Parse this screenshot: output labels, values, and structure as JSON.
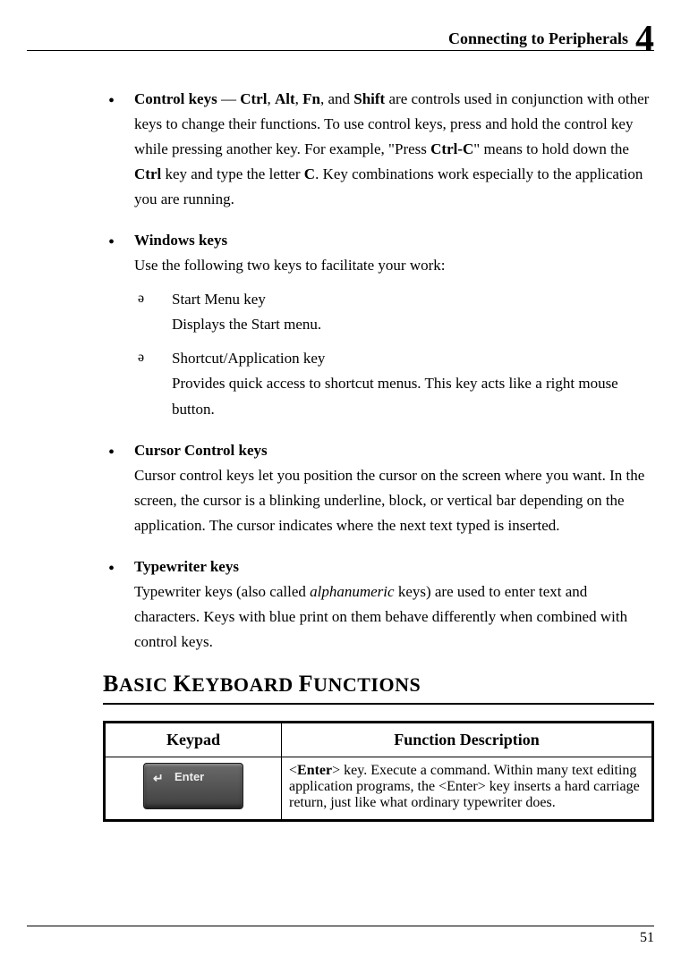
{
  "header": {
    "title": "Connecting to Peripherals",
    "chapter": "4"
  },
  "bullets": {
    "control": {
      "title": "Control keys",
      "sep": " — ",
      "k1": "Ctrl",
      "c1": ", ",
      "k2": "Alt",
      "c2": ", ",
      "k3": "Fn",
      "c3": ", and ",
      "k4": "Shift",
      "after": " are controls used in conjunction with other keys to change their functions. To use control keys, press and hold the control key while pressing another key. For example, \"Press ",
      "combo": "Ctrl-C",
      "mid1": "\" means to hold down the ",
      "ctrl": "Ctrl",
      "mid2": " key and type the letter ",
      "letter": "C",
      "end": ". Key combinations work especially to the application you are running."
    },
    "windows": {
      "title": "Windows keys",
      "desc": "Use the following two keys to facilitate your work:",
      "sub1_title": "Start Menu key",
      "sub1_desc": "Displays the Start menu.",
      "sub2_title": "Shortcut/Application key",
      "sub2_desc": "Provides quick access to shortcut menus. This key acts like a right mouse button."
    },
    "cursor": {
      "title": "Cursor Control keys",
      "desc": "Cursor control keys let you position the cursor on the screen where you want. In the screen, the cursor is a blinking underline, block, or vertical bar depending on the application. The cursor indicates where the next text typed is inserted."
    },
    "typewriter": {
      "title": "Typewriter keys",
      "t1": "Typewriter keys (also called ",
      "it": "alphanumeric",
      "t2": " keys) are used to enter text and characters. Keys with blue print on them behave differently when combined with control keys."
    }
  },
  "section_title_parts": {
    "b": "B",
    "asic": "ASIC ",
    "k": "K",
    "eyboard": "EYBOARD ",
    "f": "F",
    "unctions": "UNCTIONS"
  },
  "table": {
    "h1": "Keypad",
    "h2": "Function Description",
    "key_label": "Enter",
    "row1": {
      "p1": "<",
      "enter": "Enter",
      "p2": "> key. Execute a command. Within many text editing application programs, the <Enter> key inserts a hard carriage return, just like what ordinary typewriter does."
    }
  },
  "page_number": "51"
}
